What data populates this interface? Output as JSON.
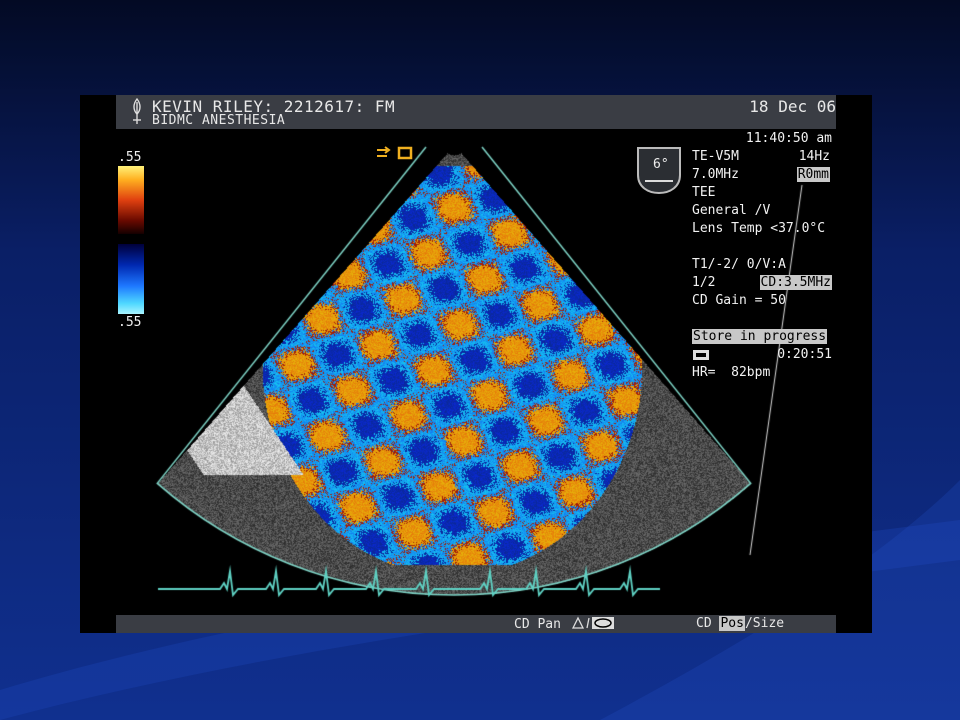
{
  "header": {
    "patient": "KEVIN RILEY: 2212617: FM",
    "institution": "BIDMC ANESTHESIA",
    "date": "18 Dec 06"
  },
  "scale": {
    "top": ".55",
    "bottom": ".55"
  },
  "probe": {
    "angle": "6°"
  },
  "settings": {
    "time": "11:40:50 am",
    "probe_model": "TE-V5M",
    "frame_rate": "14Hz",
    "frequency": "7.0MHz",
    "depth": "R0mm",
    "mode": "TEE",
    "preset": "General /V",
    "lens_temp": "Lens Temp <37.0°C",
    "params_1": "T1/-2/ 0/V:A",
    "params_2": "1/2",
    "cd_freq": "CD:3.5MHz",
    "cd_gain": "CD Gain = 50",
    "store_status": "Store in progress",
    "store_timer": "0:20:51",
    "heart_rate": "HR=  82bpm"
  },
  "footer": {
    "cd_pan": "CD Pan",
    "cd_label": "CD",
    "pos": "Pos",
    "size": "/Size"
  }
}
